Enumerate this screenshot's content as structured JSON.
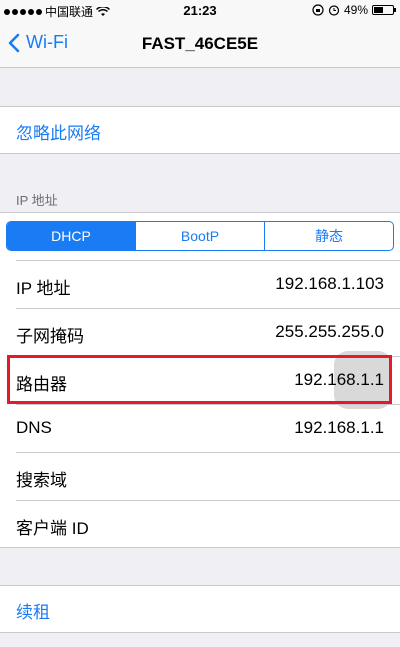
{
  "status_bar": {
    "carrier": "中国联通",
    "time": "21:23",
    "battery": "49%"
  },
  "nav": {
    "back_label": "Wi-Fi",
    "title": "FAST_46CE5E"
  },
  "forget": {
    "label": "忽略此网络"
  },
  "ip_section": {
    "header": "IP 地址",
    "segments": [
      "DHCP",
      "BootP",
      "静态"
    ],
    "selected_segment": "DHCP"
  },
  "rows": [
    {
      "label": "IP 地址",
      "value": "192.168.1.103"
    },
    {
      "label": "子网掩码",
      "value": "255.255.255.0"
    },
    {
      "label": "路由器",
      "value": "192.168.1.1"
    },
    {
      "label": "DNS",
      "value": "192.168.1.1"
    },
    {
      "label": "搜索域",
      "value": ""
    },
    {
      "label": "客户端 ID",
      "value": ""
    }
  ],
  "renew": {
    "label": "续租"
  },
  "colors": {
    "accent": "#1a7cf5",
    "highlight": "#e21a2a"
  }
}
